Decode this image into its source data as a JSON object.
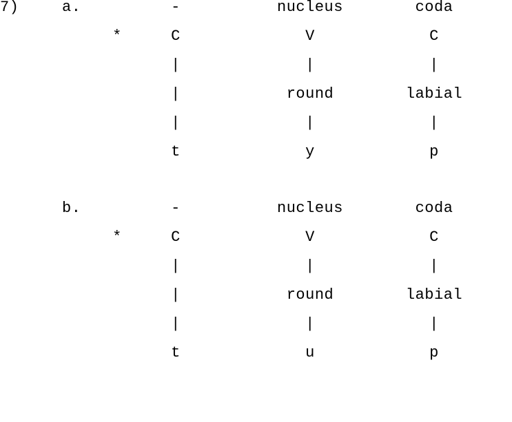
{
  "example_number": "7)",
  "diagrams": [
    {
      "letter": "a.",
      "star": "*",
      "columns": [
        {
          "header": "-",
          "slot": "C",
          "feature": "",
          "segment": "t",
          "connectors": [
            "|",
            "|",
            "|"
          ]
        },
        {
          "header": "nucleus",
          "slot": "V",
          "feature": "round",
          "segment": "y",
          "connectors": [
            "|",
            "|"
          ]
        },
        {
          "header": "coda",
          "slot": "C",
          "feature": "labial",
          "segment": "p",
          "connectors": [
            "|",
            "|"
          ]
        }
      ]
    },
    {
      "letter": "b.",
      "star": "*",
      "columns": [
        {
          "header": "-",
          "slot": "C",
          "feature": "",
          "segment": "t",
          "connectors": [
            "|",
            "|",
            "|"
          ]
        },
        {
          "header": "nucleus",
          "slot": "V",
          "feature": "round",
          "segment": "u",
          "connectors": [
            "|",
            "|"
          ]
        },
        {
          "header": "coda",
          "slot": "C",
          "feature": "labial",
          "segment": "p",
          "connectors": [
            "|",
            "|"
          ]
        }
      ]
    }
  ]
}
